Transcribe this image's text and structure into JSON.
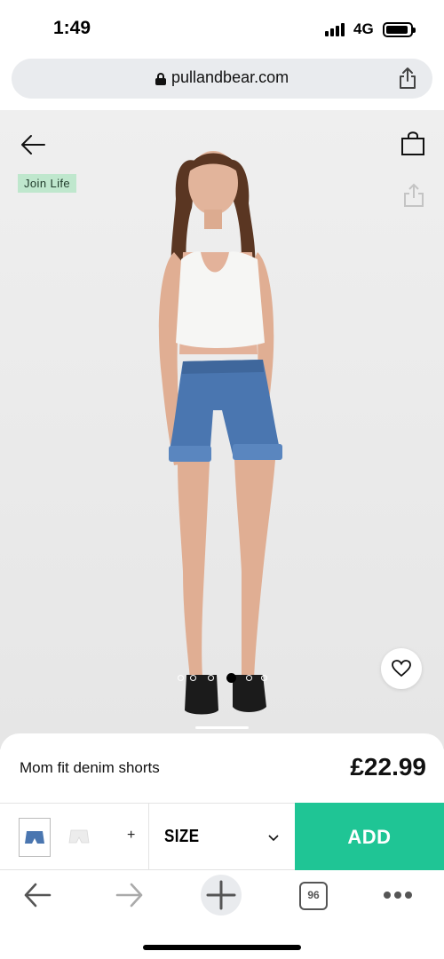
{
  "status_bar": {
    "time": "1:49",
    "network": "4G"
  },
  "browser": {
    "url": "pullandbear.com"
  },
  "product": {
    "badge": "Join Life",
    "name": "Mom fit denim shorts",
    "price": "£22.99",
    "image_count": 6,
    "active_image": 3,
    "colors": [
      {
        "name": "denim-blue",
        "hex": "#4a76b0",
        "selected": true
      },
      {
        "name": "white",
        "hex": "#f2f2f2",
        "selected": false
      }
    ],
    "more_colors_label": "+",
    "size_label": "SIZE",
    "add_label": "ADD"
  },
  "toolbar": {
    "tabs_count": "96"
  },
  "theme": {
    "accent": "#1fc595",
    "badge_bg": "#bfe7cd"
  }
}
